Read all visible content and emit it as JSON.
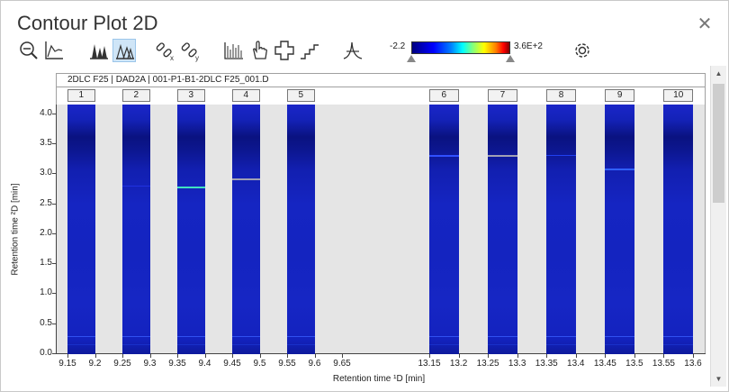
{
  "window": {
    "title": "Contour Plot 2D"
  },
  "toolbar": {
    "items": [
      {
        "name": "zoom-out-icon",
        "active": false
      },
      {
        "name": "axes-icon",
        "active": false
      },
      {
        "name": "peaks-icon",
        "active": false
      },
      {
        "name": "peaks-contour-icon",
        "active": true
      },
      {
        "name": "link-x-icon",
        "active": false
      },
      {
        "name": "link-y-icon",
        "active": false
      },
      {
        "name": "bar-chart-icon",
        "active": false
      },
      {
        "name": "hand-pan-icon",
        "active": false
      },
      {
        "name": "crosshair-icon",
        "active": false
      },
      {
        "name": "step-icon",
        "active": false
      },
      {
        "name": "peak-shape-icon",
        "active": false
      },
      {
        "name": "gear-icon",
        "active": false
      }
    ]
  },
  "colorbar": {
    "min_label": "-2.2",
    "max_label": "3.6E+2",
    "low_slider": 0.0,
    "high_slider": 1.0
  },
  "plot": {
    "header": "2DLC F25 | DAD2A | 001-P1-B1-2DLC F25_001.D",
    "ylabel": "Retention time ²D [min]",
    "xlabel": "Retention time ¹D [min]"
  },
  "chart_data": {
    "type": "heatmap",
    "title": "2DLC F25 | DAD2A | 001-P1-B1-2DLC F25_001.D",
    "xlabel": "Retention time ¹D [min]",
    "ylabel": "Retention time ²D [min]",
    "ylim": [
      0.0,
      4.15
    ],
    "yticks": [
      "0.0",
      "0.5",
      "1.0",
      "1.5",
      "2.0",
      "2.5",
      "3.0",
      "3.5",
      "4.0"
    ],
    "ytick_values": [
      0.0,
      0.5,
      1.0,
      1.5,
      2.0,
      2.5,
      3.0,
      3.5,
      4.0
    ],
    "xticks_left": [
      "9.15",
      "9.2",
      "9.25",
      "9.3",
      "9.35",
      "9.4",
      "9.45",
      "9.5",
      "9.55",
      "9.6",
      "9.65"
    ],
    "xticks_right": [
      "13.15",
      "13.2",
      "13.25",
      "13.3",
      "13.35",
      "13.4",
      "13.45",
      "13.5",
      "13.55",
      "13.6"
    ],
    "columns": [
      {
        "label": "1",
        "x_start": 9.15,
        "x_end": 9.2
      },
      {
        "label": "2",
        "x_start": 9.25,
        "x_end": 9.3
      },
      {
        "label": "3",
        "x_start": 9.35,
        "x_end": 9.4
      },
      {
        "label": "4",
        "x_start": 9.45,
        "x_end": 9.5
      },
      {
        "label": "5",
        "x_start": 9.55,
        "x_end": 9.6
      },
      {
        "label": "6",
        "x_start": 13.15,
        "x_end": 13.2
      },
      {
        "label": "7",
        "x_start": 13.25,
        "x_end": 13.3
      },
      {
        "label": "8",
        "x_start": 13.35,
        "x_end": 13.4
      },
      {
        "label": "9",
        "x_start": 13.45,
        "x_end": 13.5
      },
      {
        "label": "10",
        "x_start": 13.55,
        "x_end": 13.6
      }
    ],
    "peaks": [
      {
        "column": "3",
        "y": 2.76,
        "color": "#40e0c0"
      },
      {
        "column": "4",
        "y": 2.9,
        "color": "#a0a0b4"
      },
      {
        "column": "6",
        "y": 3.3,
        "color": "#3050ff"
      },
      {
        "column": "7",
        "y": 3.3,
        "color": "#a0a0b4"
      },
      {
        "column": "8",
        "y": 3.3,
        "color": "#2040f0"
      },
      {
        "column": "9",
        "y": 3.07,
        "color": "#3060ff"
      },
      {
        "column": "2",
        "y": 2.78,
        "color": "#2030e0"
      }
    ],
    "baseline_bands": [
      0.28,
      0.15
    ]
  }
}
